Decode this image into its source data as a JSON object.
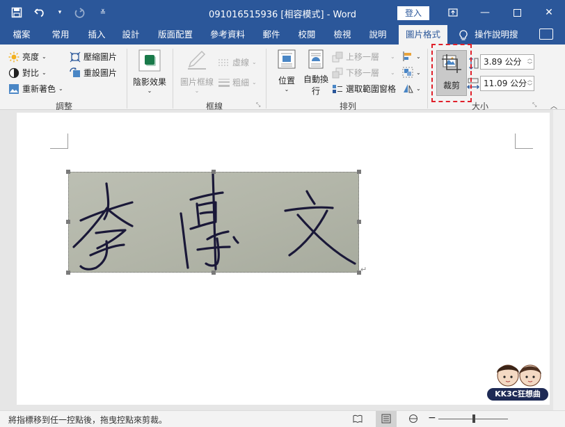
{
  "window": {
    "title": "091016515936 [相容模式]  -  Word",
    "signin_label": "登入"
  },
  "tabs": [
    {
      "label": "檔案"
    },
    {
      "label": "常用"
    },
    {
      "label": "插入"
    },
    {
      "label": "設計"
    },
    {
      "label": "版面配置"
    },
    {
      "label": "參考資料"
    },
    {
      "label": "郵件"
    },
    {
      "label": "校閱"
    },
    {
      "label": "檢視"
    },
    {
      "label": "說明"
    },
    {
      "label": "圖片格式",
      "active": true
    }
  ],
  "tell_me": "操作說明搜",
  "ribbon": {
    "adjust": {
      "brightness": "亮度",
      "contrast": "對比",
      "recolor": "重新著色",
      "compress": "壓縮圖片",
      "reset": "重設圖片",
      "label": "調整"
    },
    "shadow": {
      "label": "陰影效果"
    },
    "border": {
      "frame": "圖片框線",
      "dashes": "虛線",
      "weight": "粗細",
      "label": "框線"
    },
    "arrange": {
      "position": "位置",
      "wrap_line1": "自動換",
      "wrap_line2": "行",
      "bring_forward": "上移一層",
      "send_backward": "下移一層",
      "selection_pane": "選取範圍窗格",
      "label": "排列"
    },
    "size": {
      "crop": "裁剪",
      "height": "3.89 公分",
      "width": "11.09 公分",
      "label": "大小"
    }
  },
  "status": {
    "message": "將指標移到任一控點後，拖曳控點來剪裁。"
  },
  "watermark": "KK3C狂想曲",
  "colors": {
    "accent": "#2b579a",
    "ribbon_bg": "#f3f3f3",
    "highlight": "#e0202a"
  }
}
